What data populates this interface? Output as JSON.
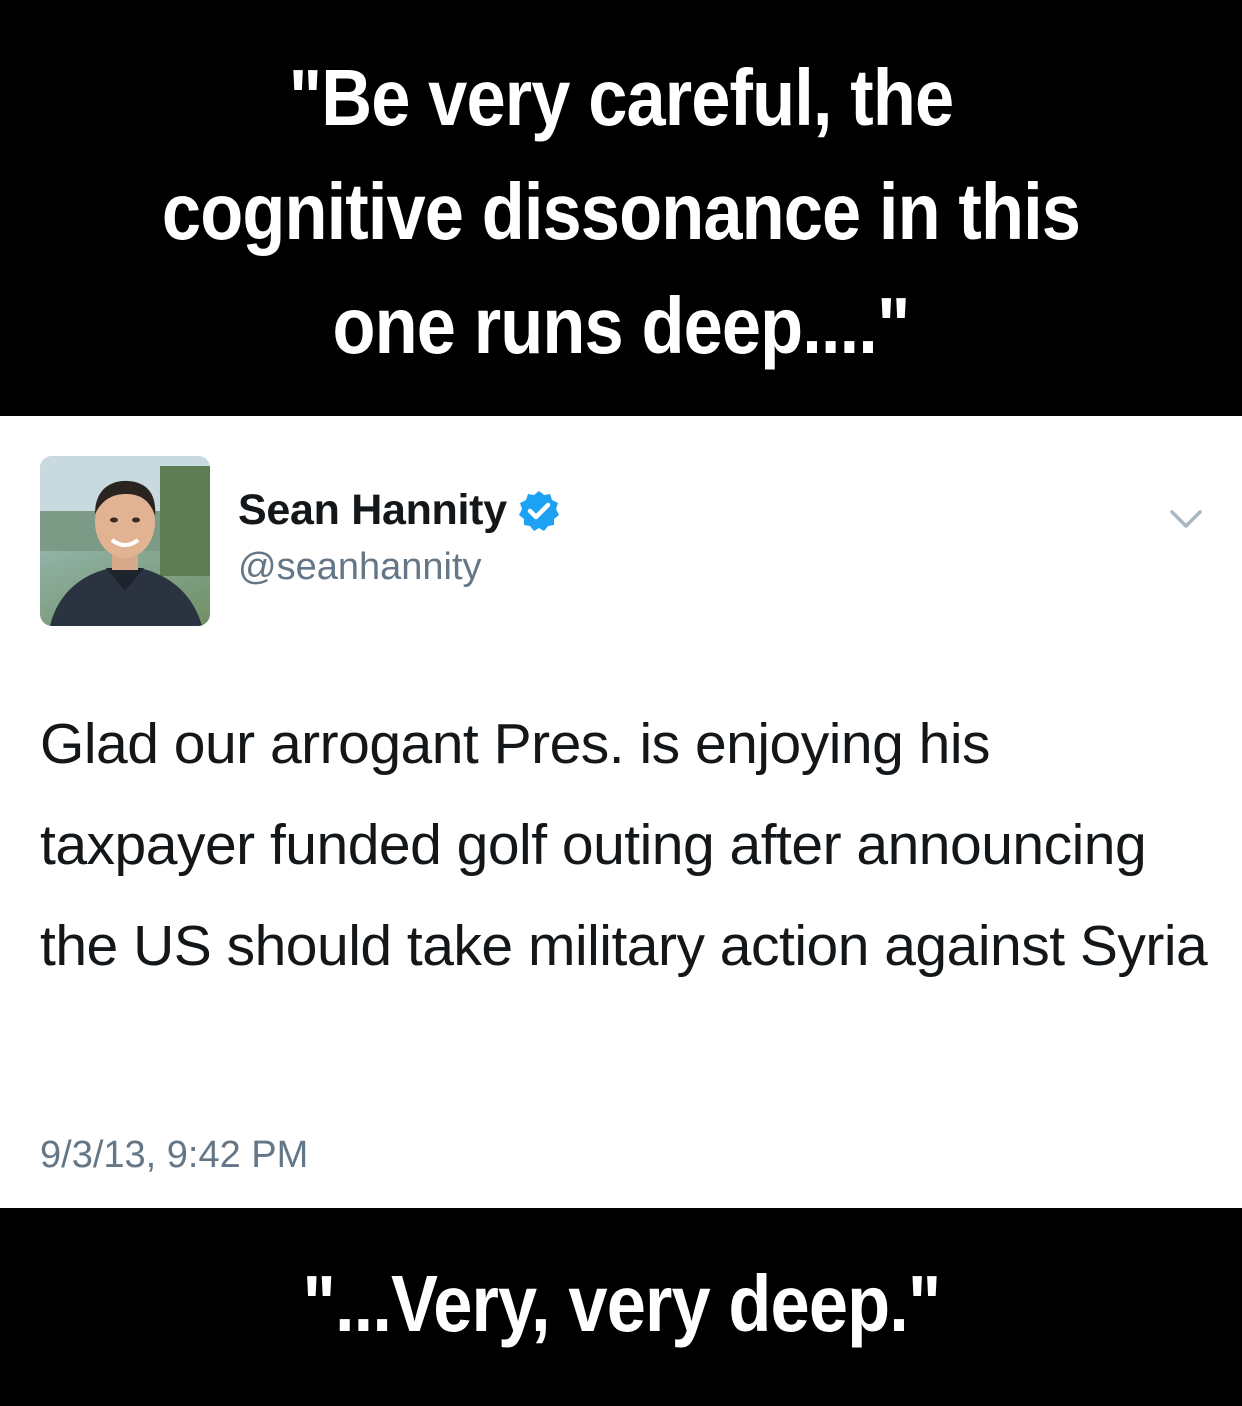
{
  "top_caption": "\"Be very careful, the\ncognitive dissonance in this\none runs deep....\"",
  "tweet": {
    "display_name": "Sean Hannity",
    "handle": "@seanhannity",
    "verified": true,
    "text": "Glad our arrogant Pres. is enjoying his taxpayer funded golf outing after announcing the US should take military action against Syria",
    "timestamp": "9/3/13, 9:42 PM"
  },
  "bottom_caption": "\"...Very, very deep.\"",
  "icons": {
    "verified": "verified-badge-icon",
    "menu": "chevron-down-icon"
  },
  "colors": {
    "banner_bg": "#000000",
    "banner_text": "#ffffff",
    "card_bg": "#ffffff",
    "name_text": "#14171a",
    "secondary_text": "#657786",
    "verified_blue": "#1da1f2"
  }
}
